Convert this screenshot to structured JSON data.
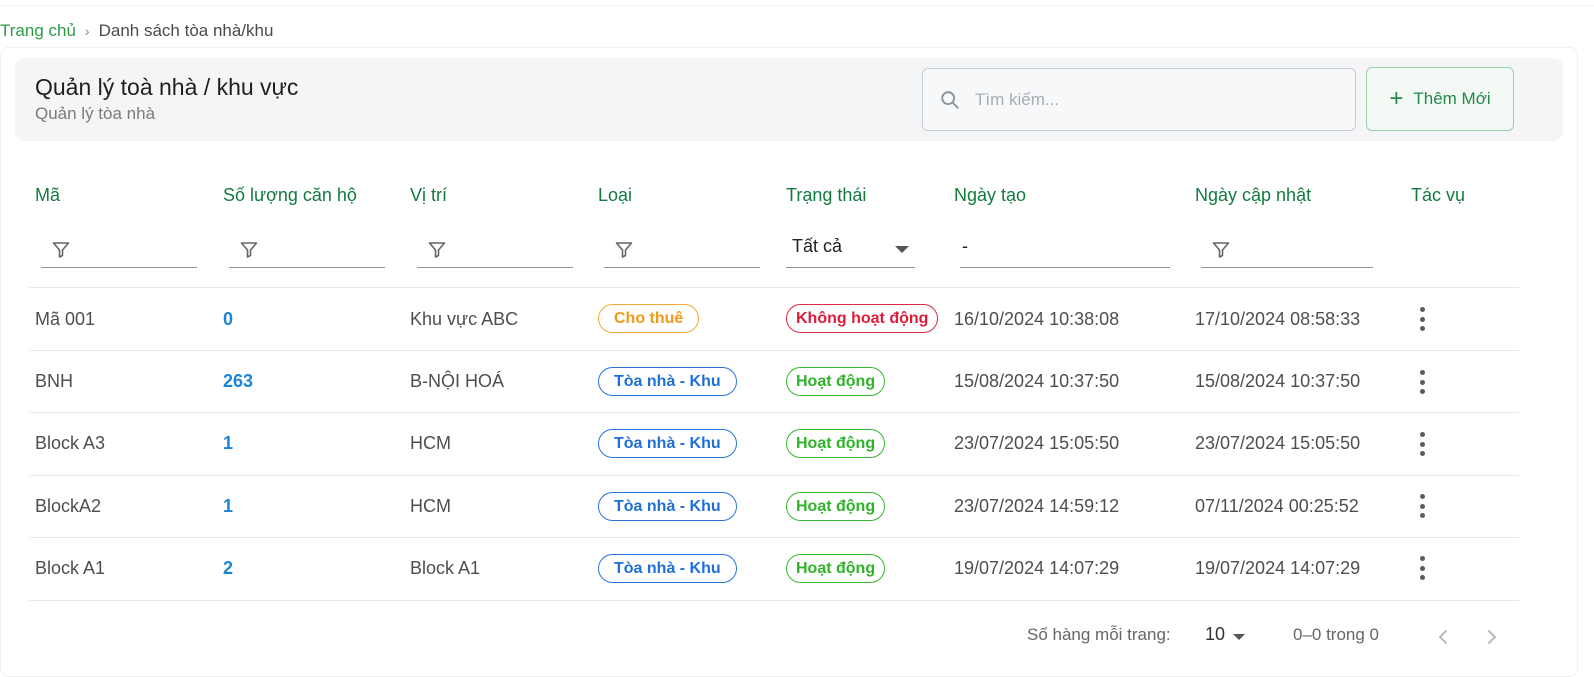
{
  "breadcrumb": {
    "home": "Trang chủ",
    "separator": "›",
    "current": "Danh sách tòa nhà/khu"
  },
  "header": {
    "title": "Quản lý toà nhà / khu vực",
    "subtitle": "Quản lý tòa nhà"
  },
  "search": {
    "placeholder": "Tìm kiếm...",
    "value": "",
    "icon": "search-icon"
  },
  "add_button": {
    "icon": "plus-icon",
    "label": "Thêm Mới"
  },
  "columns": {
    "code": "Mã",
    "apartments": "Số lượng căn hộ",
    "location": "Vị trí",
    "type": "Loại",
    "status": "Trạng thái",
    "created": "Ngày tạo",
    "updated": "Ngày cập nhật",
    "actions": "Tác vụ"
  },
  "filters": {
    "status_value": "Tất cả",
    "created_value": "-",
    "filter_icon": "filter-icon"
  },
  "rows": [
    {
      "code": "Mã 001",
      "apartments": "0",
      "location": "Khu vực ABC",
      "type": "Cho thuê",
      "status": "Không hoạt động",
      "created": "16/10/2024 10:38:08",
      "updated": "17/10/2024 08:58:33"
    },
    {
      "code": "BNH",
      "apartments": "263",
      "location": "B-NỘI HOÁ",
      "type": "Tòa nhà - Khu",
      "status": "Hoạt động",
      "created": "15/08/2024 10:37:50",
      "updated": "15/08/2024 10:37:50"
    },
    {
      "code": "Block A3",
      "apartments": "1",
      "location": "HCM",
      "type": "Tòa nhà - Khu",
      "status": "Hoạt động",
      "created": "23/07/2024 15:05:50",
      "updated": "23/07/2024 15:05:50"
    },
    {
      "code": "BlockA2",
      "apartments": "1",
      "location": "HCM",
      "type": "Tòa nhà - Khu",
      "status": "Hoạt động",
      "created": "23/07/2024 14:59:12",
      "updated": "07/11/2024 00:25:52"
    },
    {
      "code": "Block A1",
      "apartments": "2",
      "location": "Block A1",
      "type": "Tòa nhà - Khu",
      "status": "Hoạt động",
      "created": "19/07/2024 14:07:29",
      "updated": "19/07/2024 14:07:29"
    }
  ],
  "pagination": {
    "rows_per_page_label": "Số hàng mỗi trang:",
    "rows_per_page": "10",
    "range": "0–0 trong 0"
  },
  "colors": {
    "accent": "#1e8a4b",
    "header_text": "#137a3f",
    "link_blue": "#1a85d6",
    "warning": "#f19a1a",
    "danger": "#dd1c3a",
    "success": "#31b22b",
    "info": "#1e6fd8"
  }
}
